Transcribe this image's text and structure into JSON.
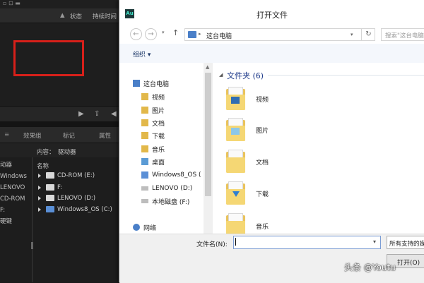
{
  "audition": {
    "files_header": {
      "status_col": "状态",
      "duration_col": "持续时间"
    },
    "panel_tabs": [
      "效果组",
      "标记",
      "属性"
    ],
    "content_label": "内容：",
    "content_value": "驱动器",
    "left_list": [
      "动器",
      "Windows",
      "LENOVO",
      "CD-ROM",
      "F:",
      "硬键"
    ],
    "name_header": "名称",
    "tree_items": [
      "CD-ROM (E:)",
      "F:",
      "LENOVO (D:)",
      "Windows8_OS (C:)"
    ]
  },
  "dialog": {
    "app_icon": "Au",
    "title": "打开文件",
    "address": "这台电脑",
    "search_placeholder": "搜索\"这台电脑\"",
    "organize": "组织 ▾",
    "nav_items": [
      "这台电脑",
      "视频",
      "图片",
      "文档",
      "下载",
      "音乐",
      "桌面",
      "Windows8_OS (",
      "LENOVO (D:)",
      "本地磁盘 (F:)",
      "网络"
    ],
    "group_header": "文件夹 (6)",
    "folders": [
      "视频",
      "图片",
      "文档",
      "下载",
      "音乐"
    ],
    "filename_label": "文件名(N):",
    "filename_value": "",
    "filetype_value": "所有支持的媒",
    "open_button": "打开(O)"
  },
  "watermark": "头条 @Youtu",
  "colors": {
    "highlight_box": "#d7201a",
    "folder": "#f5d774",
    "link_blue": "#1e3a8a"
  }
}
